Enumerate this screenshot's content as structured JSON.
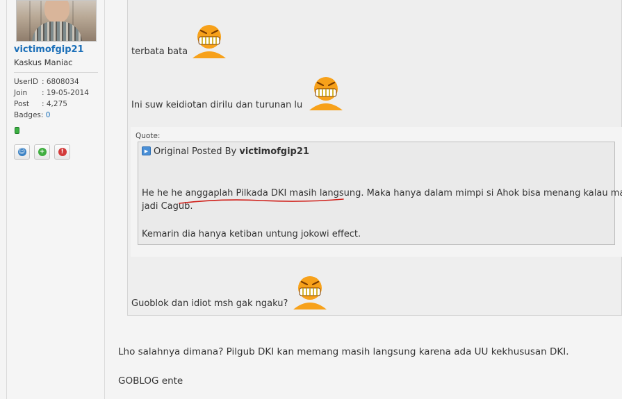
{
  "profile": {
    "username": "victimofgip21",
    "rank": "Kaskus Maniac",
    "stats": [
      {
        "key": "UserID",
        "value": ": 6808034"
      },
      {
        "key": "Join",
        "value": ": 19-05-2014"
      },
      {
        "key": "Post",
        "value": ": 4,275"
      },
      {
        "key": "Badges",
        "value": ": ",
        "link": "0"
      }
    ]
  },
  "post": {
    "line1": "terbata bata",
    "line2": "Ini suw keidiotan dirilu dan turunan lu",
    "quote_label": "Quote:",
    "original_posted_prefix": "Original Posted By ",
    "original_poster": "victimofgip21",
    "quote_para1_plain": "He he he ",
    "quote_para1_underlined": "anggaplah Pilkada DKI masih langsung",
    "quote_para1_rest": ". Maka hanya dalam mimpi si Ahok bisa menang kalau mau",
    "quote_para1_line2": "jadi Cagub.",
    "quote_para2": "Kemarin dia hanya ketiban untung jokowi effect.",
    "line3": "Guoblok dan idiot msh gak ngaku?"
  },
  "reply": {
    "line1": "Lho salahnya dimana? Pilgub DKI kan memang masih langsung karena ada UU kekhususan DKI.",
    "line2": "GOBLOG ente"
  },
  "colors": {
    "username": "#1b6fb8",
    "smiley": "#f7a11a",
    "underline": "#d0201a",
    "online": "#3cb043"
  },
  "icons": [
    "avatar-photo",
    "online-status-icon",
    "view-profile-icon",
    "add-friend-icon",
    "report-icon",
    "grinning-smiley-icon",
    "quote-arrow-icon"
  ]
}
